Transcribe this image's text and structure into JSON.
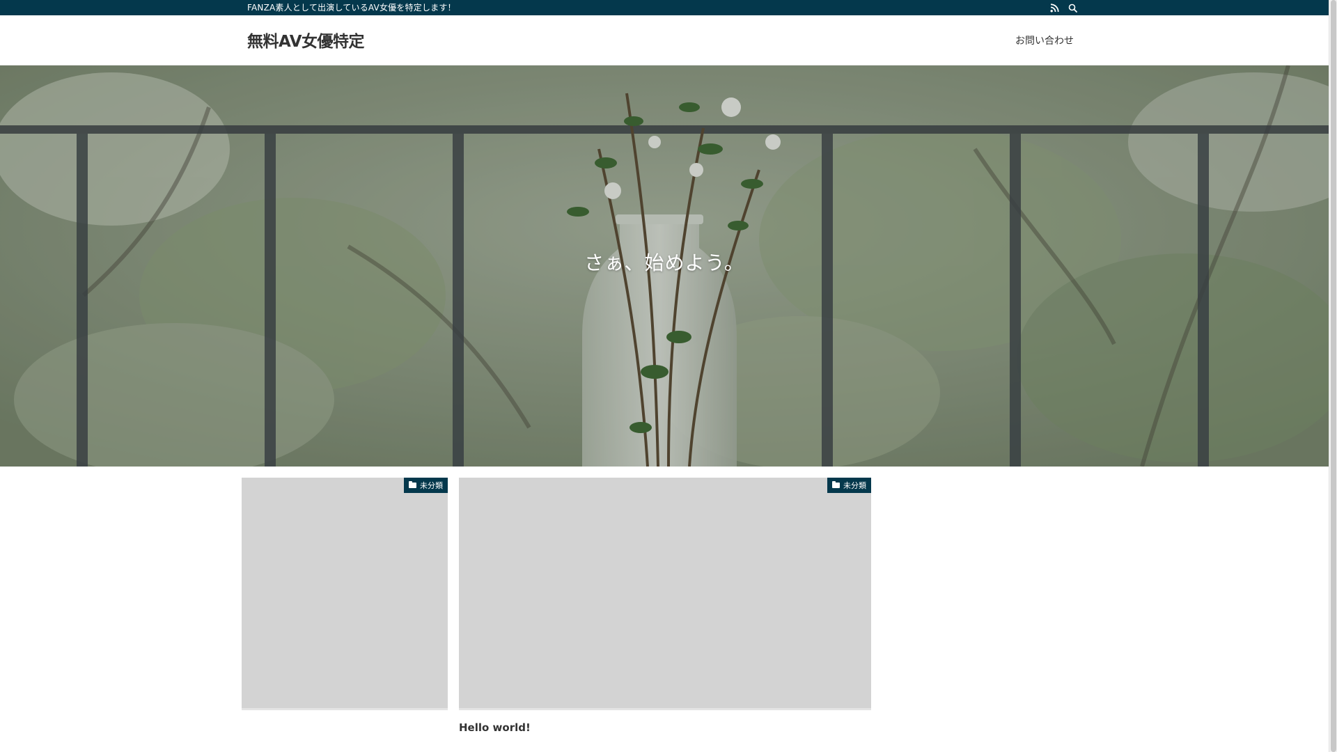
{
  "topbar": {
    "tagline": "FANZA素人として出演しているAV女優を特定します！",
    "icons": [
      "rss-icon",
      "search-icon"
    ]
  },
  "header": {
    "site_title": "無料AV女優特定",
    "nav": [
      {
        "label": "お問い合わせ"
      }
    ]
  },
  "hero": {
    "text": "さぁ、始めよう。"
  },
  "posts": [
    {
      "category": "未分類",
      "title": ""
    },
    {
      "category": "未分類",
      "title": "Hello world!"
    }
  ],
  "colors": {
    "accent": "#04384c",
    "thumb_placeholder": "#d3d3d3",
    "text": "#333333"
  }
}
